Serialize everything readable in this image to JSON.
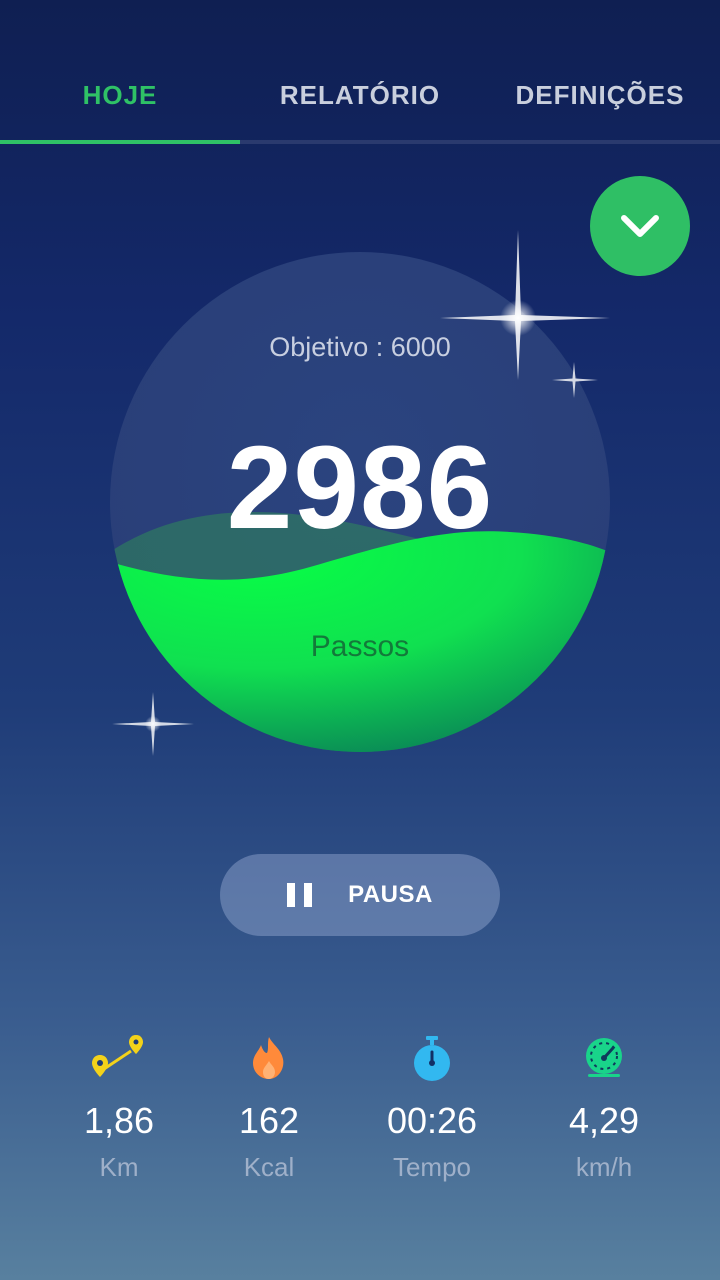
{
  "tabs": [
    {
      "label": "HOJE",
      "active": true
    },
    {
      "label": "RELATÓRIO",
      "active": false
    },
    {
      "label": "DEFINIÇÕES",
      "active": false
    }
  ],
  "colors": {
    "accent": "#2fc266",
    "fill": "#08f24a"
  },
  "counter": {
    "goal_text": "Objetivo : 6000",
    "steps": "2986",
    "steps_label": "Passos",
    "progress": 0.4977
  },
  "pause_button": {
    "label": "PAUSA",
    "icon": "pause-icon"
  },
  "stats": [
    {
      "icon": "route-icon",
      "value": "1,86",
      "unit": "Km"
    },
    {
      "icon": "flame-icon",
      "value": "162",
      "unit": "Kcal"
    },
    {
      "icon": "stopwatch-icon",
      "value": "00:26",
      "unit": "Tempo"
    },
    {
      "icon": "speedometer-icon",
      "value": "4,29",
      "unit": "km/h"
    }
  ]
}
